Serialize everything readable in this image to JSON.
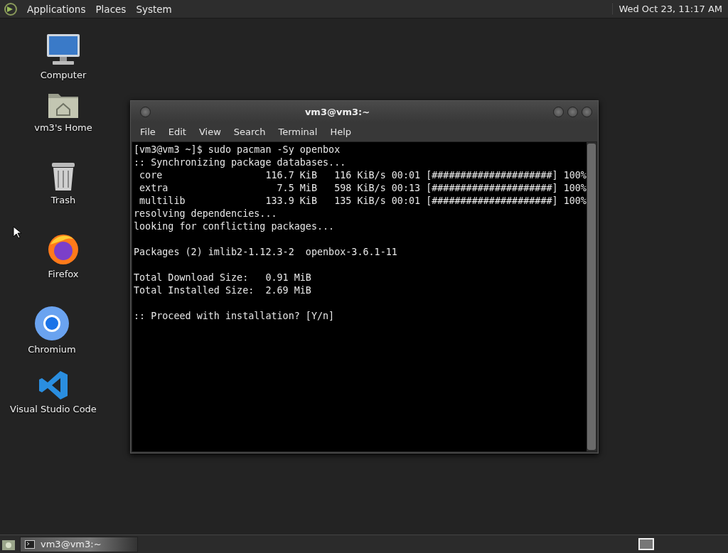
{
  "top_panel": {
    "menus": [
      "Applications",
      "Places",
      "System"
    ],
    "clock": "Wed Oct 23, 11:17 AM"
  },
  "desktop_icons": [
    {
      "kind": "computer",
      "label": "Computer"
    },
    {
      "kind": "home",
      "label": "vm3's Home"
    },
    {
      "kind": "trash",
      "label": "Trash"
    },
    {
      "kind": "firefox",
      "label": "Firefox"
    },
    {
      "kind": "chromium",
      "label": "Chromium"
    },
    {
      "kind": "vscode",
      "label": "Visual Studio Code"
    }
  ],
  "terminal": {
    "title": "vm3@vm3:~",
    "menu": [
      "File",
      "Edit",
      "View",
      "Search",
      "Terminal",
      "Help"
    ],
    "blocks": [
      [
        "[vm3@vm3 ~]$ sudo pacman -Sy openbox",
        ":: Synchronizing package databases...",
        " core                  116.7 KiB   116 KiB/s 00:01 [#####################] 100%",
        " extra                   7.5 MiB   598 KiB/s 00:13 [#####################] 100%",
        " multilib              133.9 KiB   135 KiB/s 00:01 [#####################] 100%",
        "resolving dependencies...",
        "looking for conflicting packages..."
      ],
      [
        "Packages (2) imlib2-1.12.3-2  openbox-3.6.1-11"
      ],
      [
        "Total Download Size:   0.91 MiB",
        "Total Installed Size:  2.69 MiB"
      ],
      [
        ":: Proceed with installation? [Y/n]"
      ]
    ]
  },
  "taskbar": {
    "tasks": [
      {
        "label": "vm3@vm3:~",
        "selected": true
      }
    ]
  }
}
